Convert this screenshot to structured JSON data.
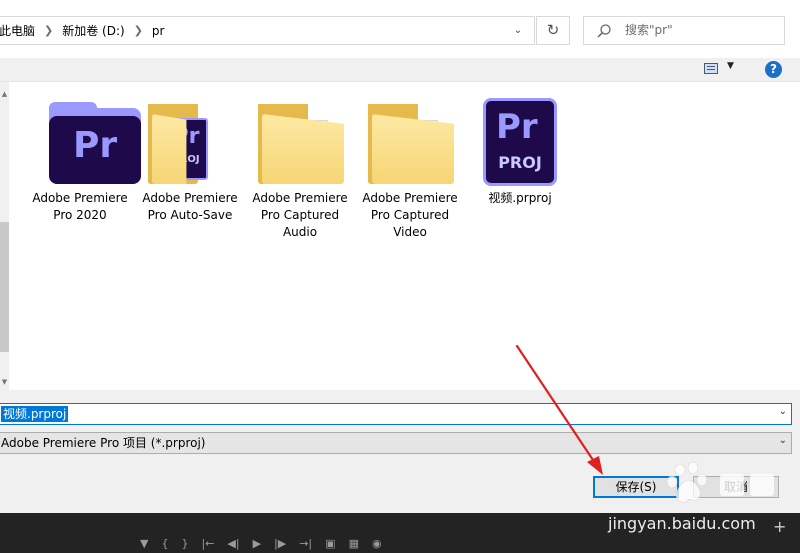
{
  "breadcrumb": {
    "items": [
      "此电脑",
      "新加卷 (D:)",
      "pr"
    ]
  },
  "search": {
    "placeholder": "搜索\"pr\""
  },
  "files": [
    {
      "label": "Adobe Premiere Pro 2020",
      "kind": "premiere-app-icon"
    },
    {
      "label": "Adobe Premiere Pro Auto-Save",
      "kind": "premiere-folder-icon"
    },
    {
      "label": "Adobe Premiere Pro Captured Audio",
      "kind": "folder-icon"
    },
    {
      "label": "Adobe Premiere Pro Captured Video",
      "kind": "folder-icon"
    },
    {
      "label": "视频.prproj",
      "kind": "premiere-project-icon"
    }
  ],
  "icons": {
    "app_glyph": "Pr",
    "proj_glyph": "PROJ"
  },
  "form": {
    "filename_value": "视频.prproj",
    "filetype_value": "Adobe Premiere Pro 项目 (*.prproj)"
  },
  "buttons": {
    "save_label": "保存(S)",
    "cancel_label": "取消"
  },
  "watermark": {
    "text": "jingyan.baidu.com"
  },
  "colors": {
    "accent": "#0078d7",
    "premiere_dark": "#1e0a4a",
    "premiere_purple": "#9999ff",
    "annotation_red": "#e02020"
  }
}
